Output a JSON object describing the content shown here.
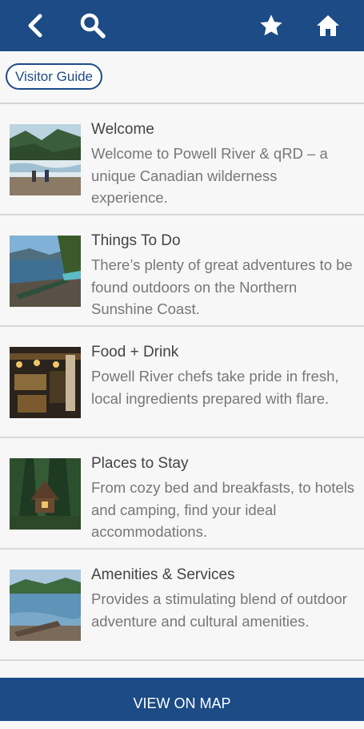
{
  "colors": {
    "primary": "#1c4b86",
    "background": "#f7f7f7"
  },
  "toolbar": {
    "back_icon": "back-chevron-icon",
    "search_icon": "search-icon",
    "favorite_icon": "star-icon",
    "home_icon": "home-icon"
  },
  "breadcrumb": {
    "label": "Visitor Guide"
  },
  "items": [
    {
      "title": "Welcome",
      "description": "Welcome to Powell River & qRD – a unique Canadian wilderness experience.",
      "image": "river-rapids-photo"
    },
    {
      "title": "Things To Do",
      "description": "There’s plenty of great adventures to be found outdoors on the Northern Sunshine Coast.",
      "image": "lake-kayak-photo"
    },
    {
      "title": "Food + Drink",
      "description": "Powell River chefs take pride in fresh, local ingredients prepared with flare.",
      "image": "restaurant-interior-photo"
    },
    {
      "title": "Places to Stay",
      "description": "From cozy bed and breakfasts, to hotels and camping, find your ideal accommodations.",
      "image": "forest-cabin-photo"
    },
    {
      "title": "Amenities & Services",
      "description": "Provides a stimulating blend of outdoor adventure and cultural amenities.",
      "image": "lake-driftwood-photo"
    }
  ],
  "footer": {
    "map_button_label": "VIEW ON MAP"
  }
}
